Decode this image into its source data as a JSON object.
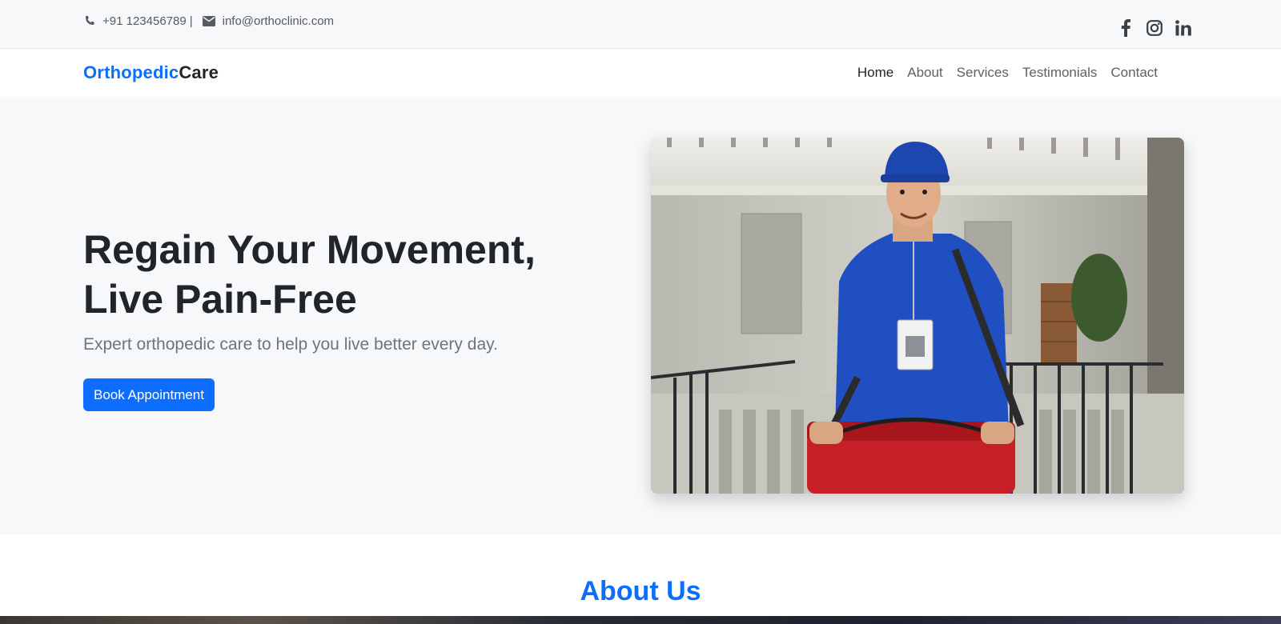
{
  "topbar": {
    "phone": "+91 123456789",
    "separator": "|",
    "email": "info@orthoclinic.com",
    "social": [
      "facebook-icon",
      "instagram-icon",
      "linkedin-icon"
    ]
  },
  "brand": {
    "part1": "Orthopedic",
    "part2": "Care"
  },
  "nav": {
    "items": [
      "Home",
      "About",
      "Services",
      "Testimonials",
      "Contact"
    ],
    "active": "Home"
  },
  "hero": {
    "title_line1": "Regain Your Movement,",
    "title_line2": "Live Pain-Free",
    "subtitle": "Expert orthopedic care to help you live better every day.",
    "cta": "Book Appointment"
  },
  "about": {
    "title": "About Us"
  },
  "colors": {
    "primary": "#0d6efd",
    "text": "#212529",
    "muted": "#6c757d",
    "bg": "#f7f8fa"
  }
}
